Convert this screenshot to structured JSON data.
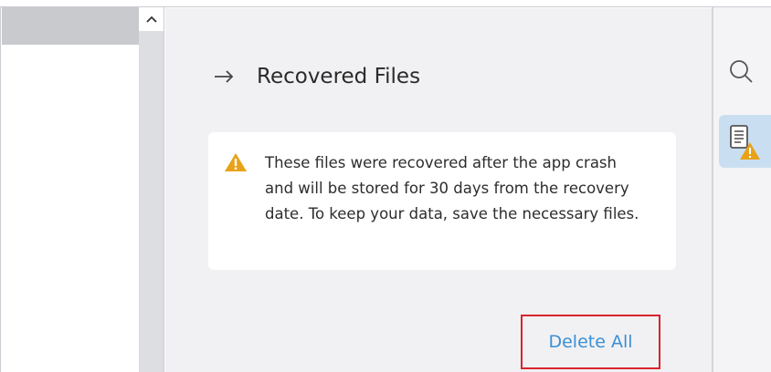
{
  "scrollbar": {
    "up_icon": "chevron-up-icon"
  },
  "recovery_panel": {
    "back_icon": "arrow-right-icon",
    "title": "Recovered Files",
    "warning_icon": "warning-triangle-icon",
    "warning_text": "These files were recovered after the app crash and will be stored for 30 days from the recovery date. To keep your data, save the necessary files.",
    "delete_all_label": "Delete All"
  },
  "right_toolbar": {
    "items": [
      {
        "icon": "search-icon"
      },
      {
        "icon": "recovered-files-warning-icon",
        "active": true
      }
    ]
  },
  "colors": {
    "accent_link": "#3a8fd6",
    "warning": "#e8a21a",
    "active_tool_bg": "#c9dff1",
    "highlight_border": "#d9232e"
  }
}
